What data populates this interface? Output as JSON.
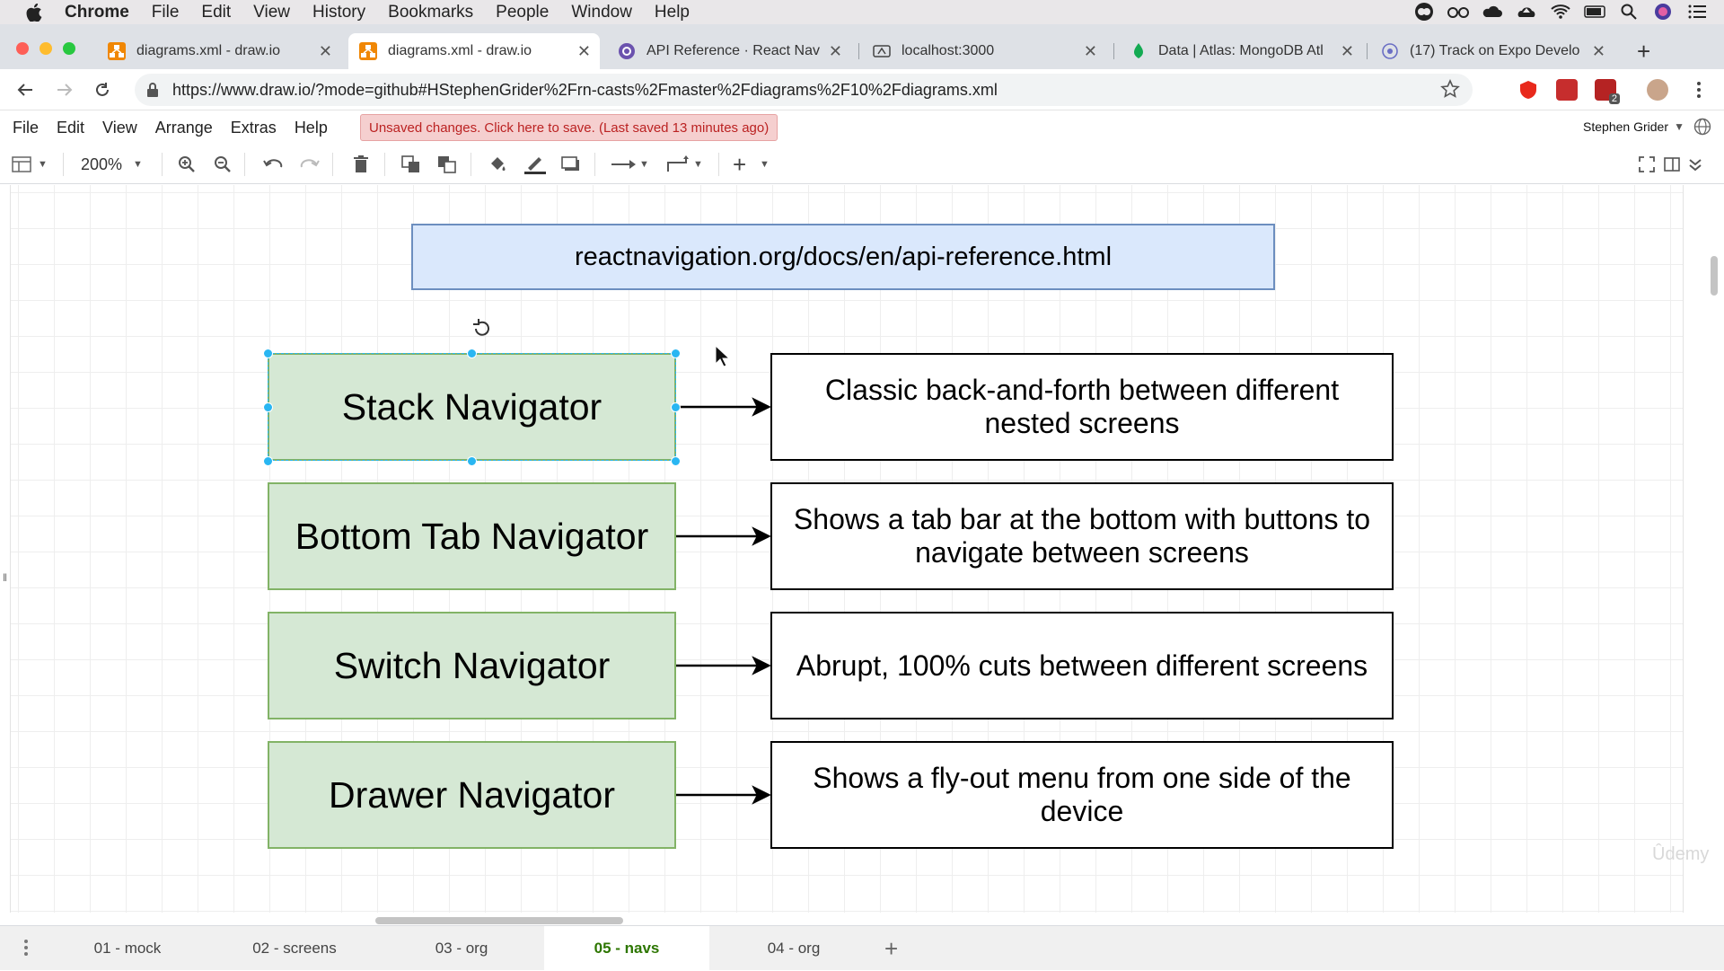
{
  "macos_menu": {
    "app": "Chrome",
    "items": [
      "File",
      "Edit",
      "View",
      "History",
      "Bookmarks",
      "People",
      "Window",
      "Help"
    ]
  },
  "tabs": [
    {
      "title": "diagrams.xml - draw.io",
      "active": false,
      "icon": "drawio-icon"
    },
    {
      "title": "diagrams.xml - draw.io",
      "active": true,
      "icon": "drawio-icon"
    },
    {
      "title": "API Reference · React Nav",
      "active": false,
      "icon": "react-navigation-icon"
    },
    {
      "title": "localhost:3000",
      "active": false,
      "icon": "expo-icon"
    },
    {
      "title": "Data | Atlas: MongoDB Atl",
      "active": false,
      "icon": "mongodb-leaf-icon"
    },
    {
      "title": "(17) Track on Expo Develo",
      "active": false,
      "icon": "expo-icon"
    }
  ],
  "address_bar": {
    "url": "https://www.draw.io/?mode=github#HStephenGrider%2Frn-casts%2Fmaster%2Fdiagrams%2F10%2Fdiagrams.xml"
  },
  "extensions": {
    "badge_count": "2"
  },
  "drawio_menu": {
    "items": [
      "File",
      "Edit",
      "View",
      "Arrange",
      "Extras",
      "Help"
    ],
    "save_notice": "Unsaved changes. Click here to save. (Last saved 13 minutes ago)",
    "user": "Stephen Grider"
  },
  "toolbar": {
    "zoom": "200%"
  },
  "diagram": {
    "url_box": "reactnavigation.org/docs/en/api-reference.html",
    "rows": [
      {
        "navigator": "Stack Navigator",
        "description": "Classic back-and-forth between different nested screens",
        "selected": true
      },
      {
        "navigator": "Bottom Tab Navigator",
        "description": "Shows a tab bar at the bottom with buttons to navigate between screens",
        "selected": false
      },
      {
        "navigator": "Switch Navigator",
        "description": "Abrupt, 100% cuts between different screens",
        "selected": false
      },
      {
        "navigator": "Drawer Navigator",
        "description": "Shows a fly-out menu from one side of the device",
        "selected": false
      }
    ]
  },
  "pages": [
    {
      "label": "01 - mock",
      "active": false
    },
    {
      "label": "02 - screens",
      "active": false
    },
    {
      "label": "03 - org",
      "active": false
    },
    {
      "label": "05 - navs",
      "active": true
    },
    {
      "label": "04 - org",
      "active": false
    }
  ],
  "watermark": "Ûdemy",
  "colors": {
    "nav_fill": "#d5e8d4",
    "nav_stroke": "#82b366",
    "url_fill": "#dae8fc",
    "url_stroke": "#6c8ebf",
    "selection": "#29b6f2",
    "active_page": "#2d7600"
  }
}
